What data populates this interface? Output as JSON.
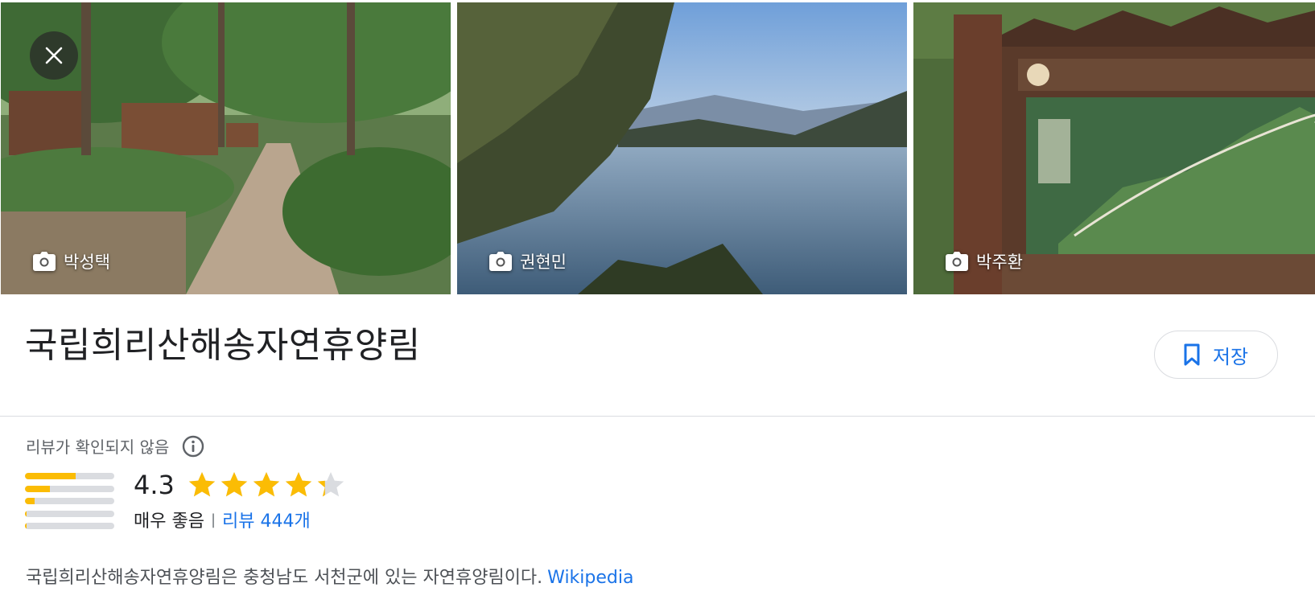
{
  "photos": [
    {
      "credit": "박성택",
      "icon": "camera-icon"
    },
    {
      "credit": "권현민",
      "icon": "camera-icon"
    },
    {
      "credit": "박주환",
      "icon": "camera-icon"
    }
  ],
  "close_icon": "close-icon",
  "place": {
    "title": "국립희리산해송자연휴양림"
  },
  "save_button": {
    "label": "저장",
    "icon": "bookmark-icon"
  },
  "reviews": {
    "unverified_label": "리뷰가 확인되지 않음",
    "info_icon": "info-icon",
    "rating": "4.3",
    "rating_value": 4.3,
    "rating_word": "매우 좋음",
    "separator": "|",
    "count_label": "리뷰 444개",
    "distribution": [
      0.57,
      0.28,
      0.11,
      0.02,
      0.02
    ]
  },
  "description": {
    "text": "국립희리산해송자연휴양림은 충청남도 서천군에 있는 자연휴양림이다.",
    "source": "Wikipedia"
  },
  "colors": {
    "accent": "#1a73e8",
    "star": "#fbbc04",
    "star_empty": "#dadce0"
  }
}
